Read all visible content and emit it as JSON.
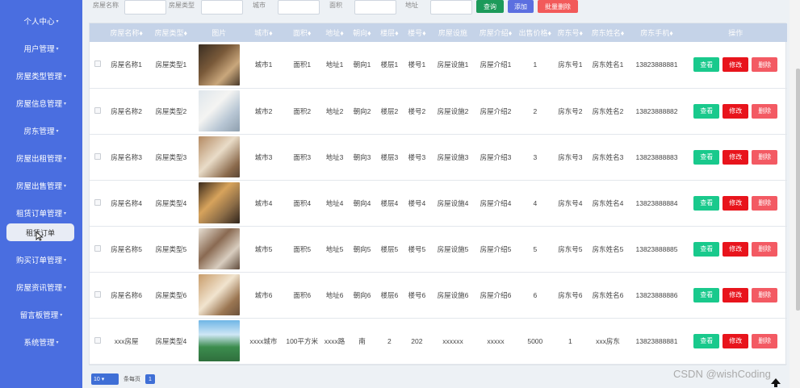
{
  "sidebar": {
    "items": [
      {
        "label": "个人中心",
        "caret": "▾"
      },
      {
        "label": "用户管理",
        "caret": "▾"
      },
      {
        "label": "房屋类型管理",
        "caret": "▾"
      },
      {
        "label": "房屋信息管理",
        "caret": "▾"
      },
      {
        "label": "房东管理",
        "caret": "▾"
      },
      {
        "label": "房屋出租管理",
        "caret": "▾"
      },
      {
        "label": "房屋出售管理",
        "caret": "▾"
      },
      {
        "label": "租赁订单管理",
        "caret": "▾"
      },
      {
        "label": "购买订单管理",
        "caret": "▾"
      },
      {
        "label": "房屋资讯管理",
        "caret": "▾"
      },
      {
        "label": "留言板管理",
        "caret": "▾"
      },
      {
        "label": "系统管理",
        "caret": "▾"
      }
    ],
    "active_sub": "租赁订单"
  },
  "search": {
    "fields": [
      "房屋名称",
      "房屋类型",
      "城市",
      "面积",
      "地址"
    ],
    "query_button": "查询",
    "add_button": "添加",
    "batch_delete_button": "批量删除"
  },
  "table": {
    "headers": [
      "房屋名称",
      "房屋类型",
      "图片",
      "城市",
      "面积",
      "地址",
      "朝向",
      "楼层",
      "楼号",
      "房屋设施",
      "房屋介绍",
      "出售价格",
      "房东号",
      "房东姓名",
      "房东手机",
      "操作"
    ],
    "sort_mark": "♦",
    "rows": [
      {
        "name": "房屋名称1",
        "type": "房屋类型1",
        "city": "城市1",
        "area": "面积1",
        "addr": "地址1",
        "facing": "朝向1",
        "floor": "楼层1",
        "bldg": "楼号1",
        "facility": "房屋设施1",
        "intro": "房屋介绍1",
        "price": "1",
        "lid": "房东号1",
        "lname": "房东姓名1",
        "phone": "13823888881",
        "view": "查看"
      },
      {
        "name": "房屋名称2",
        "type": "房屋类型2",
        "city": "城市2",
        "area": "面积2",
        "addr": "地址2",
        "facing": "朝向2",
        "floor": "楼层2",
        "bldg": "楼号2",
        "facility": "房屋设施2",
        "intro": "房屋介绍2",
        "price": "2",
        "lid": "房东号2",
        "lname": "房东姓名2",
        "phone": "13823888882",
        "view": "查看"
      },
      {
        "name": "房屋名称3",
        "type": "房屋类型3",
        "city": "城市3",
        "area": "面积3",
        "addr": "地址3",
        "facing": "朝向3",
        "floor": "楼层3",
        "bldg": "楼号3",
        "facility": "房屋设施3",
        "intro": "房屋介绍3",
        "price": "3",
        "lid": "房东号3",
        "lname": "房东姓名3",
        "phone": "13823888883",
        "view": "查看"
      },
      {
        "name": "房屋名称4",
        "type": "房屋类型4",
        "city": "城市4",
        "area": "面积4",
        "addr": "地址4",
        "facing": "朝向4",
        "floor": "楼层4",
        "bldg": "楼号4",
        "facility": "房屋设施4",
        "intro": "房屋介绍4",
        "price": "4",
        "lid": "房东号4",
        "lname": "房东姓名4",
        "phone": "13823888884",
        "view": "查看"
      },
      {
        "name": "房屋名称5",
        "type": "房屋类型5",
        "city": "城市5",
        "area": "面积5",
        "addr": "地址5",
        "facing": "朝向5",
        "floor": "楼层5",
        "bldg": "楼号5",
        "facility": "房屋设施5",
        "intro": "房屋介绍5",
        "price": "5",
        "lid": "房东号5",
        "lname": "房东姓名5",
        "phone": "13823888885",
        "view": "查看"
      },
      {
        "name": "房屋名称6",
        "type": "房屋类型6",
        "city": "城市6",
        "area": "面积6",
        "addr": "地址6",
        "facing": "朝向6",
        "floor": "楼层6",
        "bldg": "楼号6",
        "facility": "房屋设施6",
        "intro": "房屋介绍6",
        "price": "6",
        "lid": "房东号6",
        "lname": "房东姓名6",
        "phone": "13823888886",
        "view": "查看"
      },
      {
        "name": "xxx房屋",
        "type": "房屋类型4",
        "city": "xxxx城市",
        "area": "100平方米",
        "addr": "xxxx路",
        "facing": "南",
        "floor": "2",
        "bldg": "202",
        "facility": "xxxxxx",
        "intro": "xxxxx",
        "price": "5000",
        "lid": "1",
        "lname": "xxx房东",
        "phone": "13823888881",
        "view": "查看"
      }
    ],
    "edit_label": "修改",
    "delete_label": "删除"
  },
  "pager": {
    "page_size": "10",
    "total_label": "条每页",
    "current_page": "1"
  },
  "watermark": "CSDN @wishCoding",
  "colors": {
    "sidebar": "#4a6ee0",
    "view": "#19c98c",
    "edit": "#e8141c",
    "delete": "#f35a63",
    "query": "#1c9a5a",
    "add": "#5c6fe0",
    "batch_delete": "#f25a5a"
  }
}
